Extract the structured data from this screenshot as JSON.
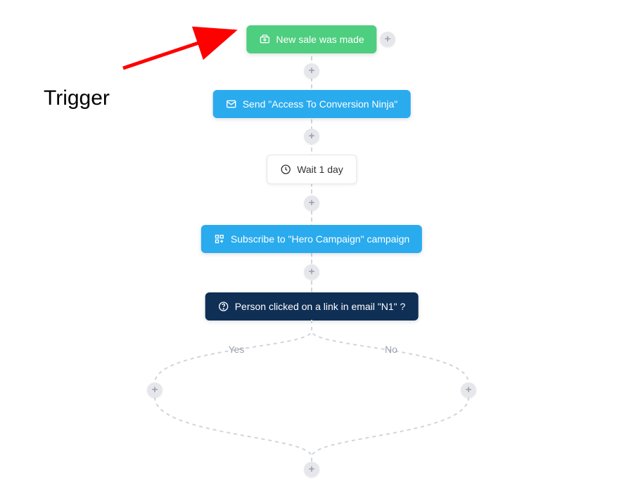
{
  "annotation": {
    "label": "Trigger"
  },
  "centerX": 443,
  "nodes": {
    "trigger": {
      "label": "New sale was made"
    },
    "send": {
      "label": "Send \"Access To Conversion Ninja\""
    },
    "wait": {
      "label": "Wait 1 day"
    },
    "subscribe": {
      "label": "Subscribe to \"Hero Campaign\" campaign"
    },
    "condition": {
      "label": "Person clicked on a link in email \"N1\" ?"
    }
  },
  "branches": {
    "yes": "Yes",
    "no": "No"
  },
  "colors": {
    "green": "#4ece7f",
    "blue": "#2aabee",
    "navy": "#0f2f55",
    "plusBg": "#e5e7eb",
    "connector": "#d1d5db",
    "arrow": "#ff0000"
  }
}
